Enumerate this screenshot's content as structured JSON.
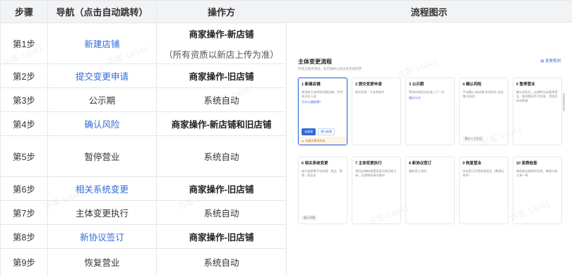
{
  "table": {
    "headers": [
      "步骤",
      "导航（点击自动跳转）",
      "操作方",
      "流程图示"
    ],
    "rows": [
      {
        "step": "第1步",
        "nav": "新建店铺",
        "nav_link": true,
        "who": "商家操作-新店铺",
        "who_bold": true,
        "who_sub": "（所有资质以新店上传为准）"
      },
      {
        "step": "第2步",
        "nav": "提交变更申请",
        "nav_link": true,
        "who": "商家操作-旧店铺",
        "who_bold": true,
        "who_sub": ""
      },
      {
        "step": "第3步",
        "nav": "公示期",
        "nav_link": false,
        "who": "系统自动",
        "who_bold": false,
        "who_sub": ""
      },
      {
        "step": "第4步",
        "nav": "确认风险",
        "nav_link": true,
        "who": "商家操作-新店铺和旧店铺",
        "who_bold": true,
        "who_sub": ""
      },
      {
        "step": "第5步",
        "nav": "暂停营业",
        "nav_link": false,
        "who": "系统自动",
        "who_bold": false,
        "who_sub": ""
      },
      {
        "step": "第6步",
        "nav": "相关系统变更",
        "nav_link": true,
        "who": "商家操作-旧店铺",
        "who_bold": true,
        "who_sub": ""
      },
      {
        "step": "第7步",
        "nav": "主体变更执行",
        "nav_link": false,
        "who": "系统自动",
        "who_bold": false,
        "who_sub": ""
      },
      {
        "step": "第8步",
        "nav": "新协议签订",
        "nav_link": true,
        "who": "商家操作-旧店铺",
        "who_bold": true,
        "who_sub": ""
      },
      {
        "step": "第9步",
        "nav": "恢复营业",
        "nav_link": false,
        "who": "系统自动",
        "who_bold": false,
        "who_sub": ""
      }
    ]
  },
  "flow": {
    "title": "主体变更流程",
    "subtitle": "完成全部步骤后，新店铺将以新主体完成经营",
    "link": "变更规则",
    "cards": [
      {
        "title": "1 新建店铺",
        "desc": "使用新主体资质创建店铺，并完成开店入驻",
        "link": "为什么要新建？",
        "btn_primary": "去新建",
        "btn_secondary": "我已新建",
        "warn": "关键步骤须完成",
        "active": true
      },
      {
        "title": "2 提交变更申请",
        "desc": "提交信息 · 平台审核中",
        "link": "",
        "tag": "",
        "active": false
      },
      {
        "title": "3 公示期",
        "desc": "等待完成后自动进入下一步",
        "link": "展示公示",
        "tag": "",
        "active": false
      },
      {
        "title": "4 确认风险",
        "desc": "手动确认 新店铺 的风险及 旧店铺 的风险",
        "link": "",
        "tag": "预计 3 工作日",
        "active": false
      },
      {
        "title": "5 暂停营业",
        "desc": "确认风险后，店铺将自动暂停营业，暂停期间不可交易，完成后自动恢复",
        "link": "",
        "tag": "",
        "active": false
      },
      {
        "title": "6 相关系统变更",
        "desc": "部分变更需手动处理 · 商品 · 营销 · 保证金",
        "link": "",
        "tag": "展示详细",
        "active": false
      },
      {
        "title": "7 主体变更执行",
        "desc": "将旧店铺的经营信息迁移至新主体，迁移期间请勿操作",
        "link": "",
        "tag": "",
        "active": false
      },
      {
        "title": "8 新协议签订",
        "desc": "重新签订协议",
        "link": "",
        "tag": "",
        "active": false
      },
      {
        "title": "9 恢复营业",
        "desc": "协议签订后将恢复营业（需满足条件）",
        "link": "",
        "tag": "",
        "active": false
      },
      {
        "title": "10 资质检查",
        "desc": "请检查店铺资质信息，确保与新主体一致",
        "link": "",
        "tag": "",
        "active": false
      }
    ]
  },
  "watermark": "访客 14041"
}
